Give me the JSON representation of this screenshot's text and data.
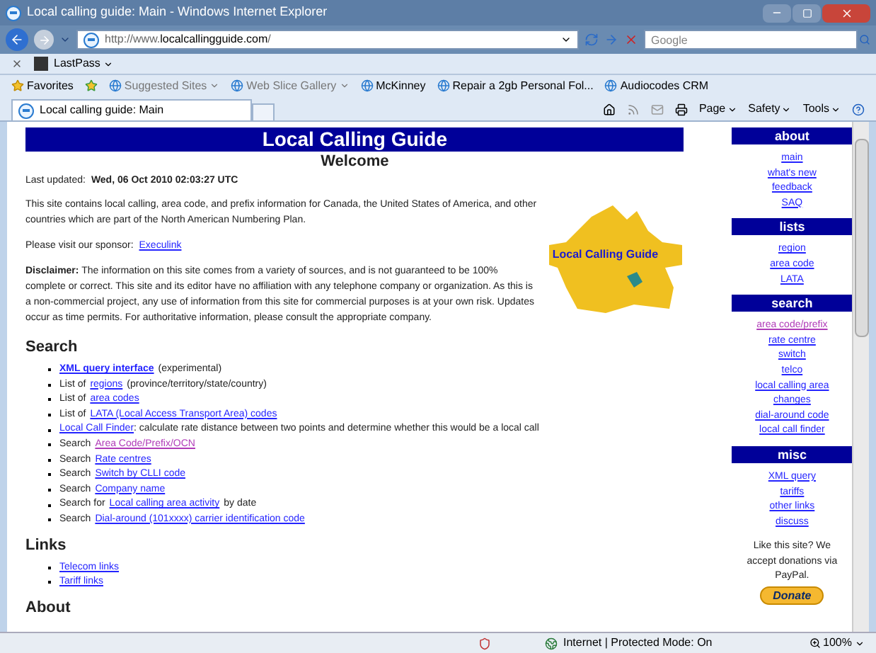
{
  "window": {
    "title": "Local calling guide: Main - Windows Internet Explorer"
  },
  "address_bar": {
    "url_prefix": "http://www.",
    "url_domain": "localcallingguide.com",
    "url_suffix": "/"
  },
  "search_box": {
    "placeholder": "Google"
  },
  "lastpass_bar": {
    "label": "LastPass"
  },
  "favorites_bar": {
    "favorites": "Favorites",
    "items": [
      {
        "label": "Suggested Sites",
        "dropdown": true,
        "dimmed": true
      },
      {
        "label": "Web Slice Gallery",
        "dropdown": true,
        "dimmed": true
      },
      {
        "label": "McKinney",
        "dropdown": false,
        "dimmed": false
      },
      {
        "label": "Repair a 2gb Personal Fol...",
        "dropdown": false,
        "dimmed": false
      },
      {
        "label": "Audiocodes CRM",
        "dropdown": false,
        "dimmed": false
      }
    ]
  },
  "tab": {
    "label": "Local calling guide: Main"
  },
  "command_bar": [
    "Page",
    "Safety",
    "Tools"
  ],
  "page": {
    "banner": "Local Calling Guide",
    "heading": "Welcome",
    "updated_label": "Last updated:",
    "updated_value": "Wed, 06 Oct 2010 02:03:27 UTC",
    "intro": "This site contains local calling, area code, and prefix information for Canada, the United States of America, and other countries which are part of the North American Numbering Plan.",
    "sponsor_label": "Please visit our sponsor:",
    "sponsor_link": "Execulink",
    "disclaimer_label": "Disclaimer:",
    "disclaimer": "The information on this site comes from a variety of sources, and is not guaranteed to be 100% complete or correct. This site and its editor have no affiliation with any telephone company or organization. As this is a non-commercial project, any use of information from this site for commercial purposes is at your own risk. Updates occur as time permits. For authoritative information, please consult the appropriate company.",
    "logo_text": "Local Calling Guide",
    "sections": [
      {
        "title": "Search",
        "items": [
          {
            "link": "XML query interface",
            "suffix": "(experimental)",
            "strong": true,
            "visited": false
          },
          {
            "prefix": "List of",
            "link": "regions",
            "suffix": "(province/territory/state/country)",
            "strong": false,
            "visited": false
          },
          {
            "prefix": "List of",
            "link": "area codes",
            "strong": false,
            "visited": false
          },
          {
            "prefix": "List of",
            "link": "LATA (Local Access Transport Area) codes",
            "strong": false,
            "visited": false
          },
          {
            "link": "Local Call Finder",
            "suffix": ": calculate rate distance between two points and determine whether this would be a local call",
            "strong": false,
            "visited": false
          },
          {
            "prefix": "Search",
            "link": "Area Code/Prefix/OCN",
            "strong": false,
            "visited": true
          },
          {
            "prefix": "Search",
            "link": "Rate centres",
            "strong": false,
            "visited": false
          },
          {
            "prefix": "Search",
            "link": "Switch by CLLI code",
            "strong": false,
            "visited": false
          },
          {
            "prefix": "Search",
            "link": "Company name",
            "strong": false,
            "visited": false
          },
          {
            "prefix": "Search for",
            "link": "Local calling area activity",
            "suffix": "by date",
            "strong": false,
            "visited": false
          },
          {
            "prefix": "Search",
            "link": "Dial-around (101xxxx) carrier identification code",
            "strong": false,
            "visited": false
          }
        ]
      },
      {
        "title": "Links",
        "items": [
          {
            "link": "Telecom links",
            "strong": false,
            "visited": false
          },
          {
            "link": "Tariff links",
            "strong": false,
            "visited": false
          }
        ]
      },
      {
        "title": "About"
      }
    ]
  },
  "sidebar": {
    "groups": [
      {
        "title": "about",
        "links": [
          {
            "label": "main",
            "visited": false
          },
          {
            "label": "what's new",
            "visited": false
          },
          {
            "label": "feedback",
            "visited": false
          },
          {
            "label": "SAQ",
            "visited": false
          }
        ]
      },
      {
        "title": "lists",
        "links": [
          {
            "label": "region",
            "visited": false
          },
          {
            "label": "area code",
            "visited": false
          },
          {
            "label": "LATA",
            "visited": false
          }
        ]
      },
      {
        "title": "search",
        "links": [
          {
            "label": "area code/prefix",
            "visited": true
          },
          {
            "label": "rate centre",
            "visited": false
          },
          {
            "label": "switch",
            "visited": false
          },
          {
            "label": "telco",
            "visited": false
          },
          {
            "label": "local calling area",
            "visited": false
          },
          {
            "label": "changes",
            "visited": false
          },
          {
            "label": "dial-around code",
            "visited": false
          },
          {
            "label": "local call finder",
            "visited": false
          }
        ]
      },
      {
        "title": "misc",
        "links": [
          {
            "label": "XML query",
            "visited": false
          },
          {
            "label": "tariffs",
            "visited": false
          },
          {
            "label": "other links",
            "visited": false
          },
          {
            "label": "discuss",
            "visited": false
          }
        ]
      }
    ],
    "donate_text": "Like this site? We accept donations via PayPal.",
    "donate_button": "Donate"
  },
  "status_bar": {
    "zone": "Internet | Protected Mode: On",
    "zoom": "100%"
  }
}
